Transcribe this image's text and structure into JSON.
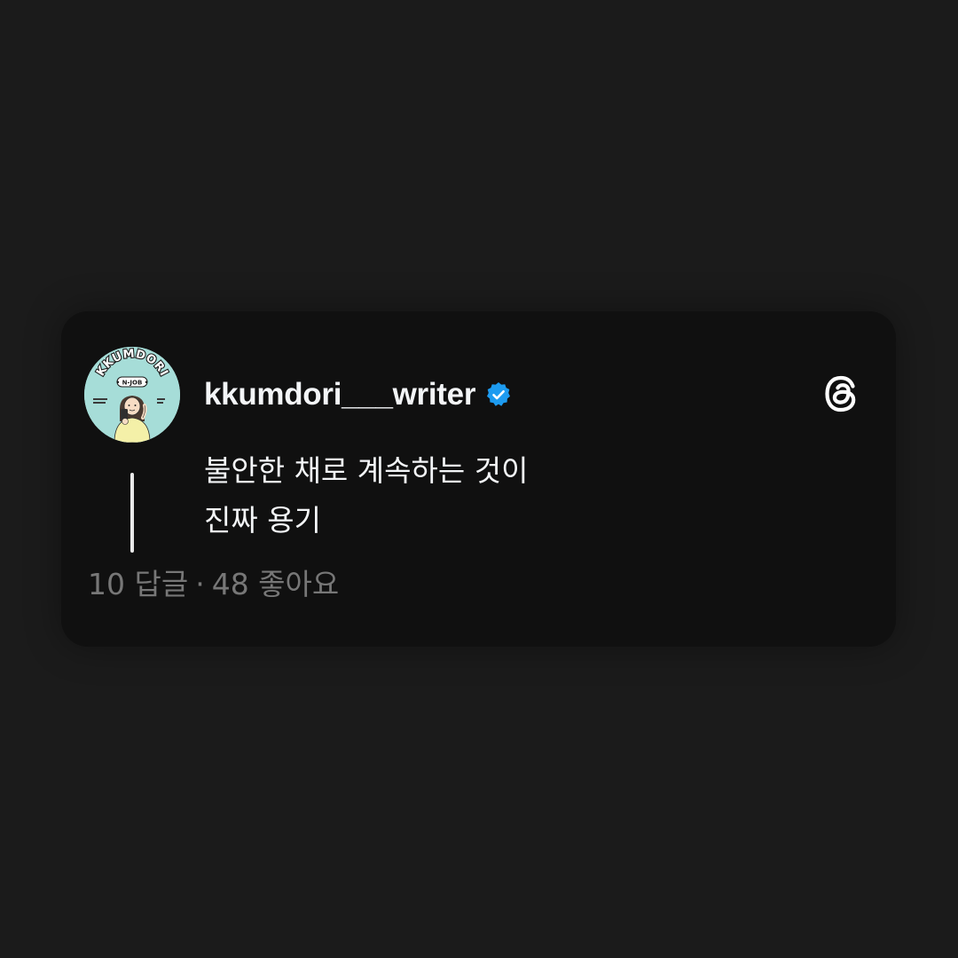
{
  "post": {
    "avatar": {
      "brand": "KKUMDORI",
      "tagline": "• N-JOB •",
      "background_color": "#a6ddd8"
    },
    "username": "kkumdori___writer",
    "verified_icon": "verified-badge-icon",
    "verified_color": "#1d9bf0",
    "app_icon": "threads-logo-icon",
    "body_lines": [
      "불안한 채로 계속하는 것이",
      "진짜 용기"
    ],
    "replies": "10 답글",
    "separator": "·",
    "likes": "48 좋아요"
  },
  "colors": {
    "page_background": "#1b1b1b",
    "card_background": "#101010",
    "primary_text": "#f3f5f7",
    "secondary_text": "#777777"
  }
}
